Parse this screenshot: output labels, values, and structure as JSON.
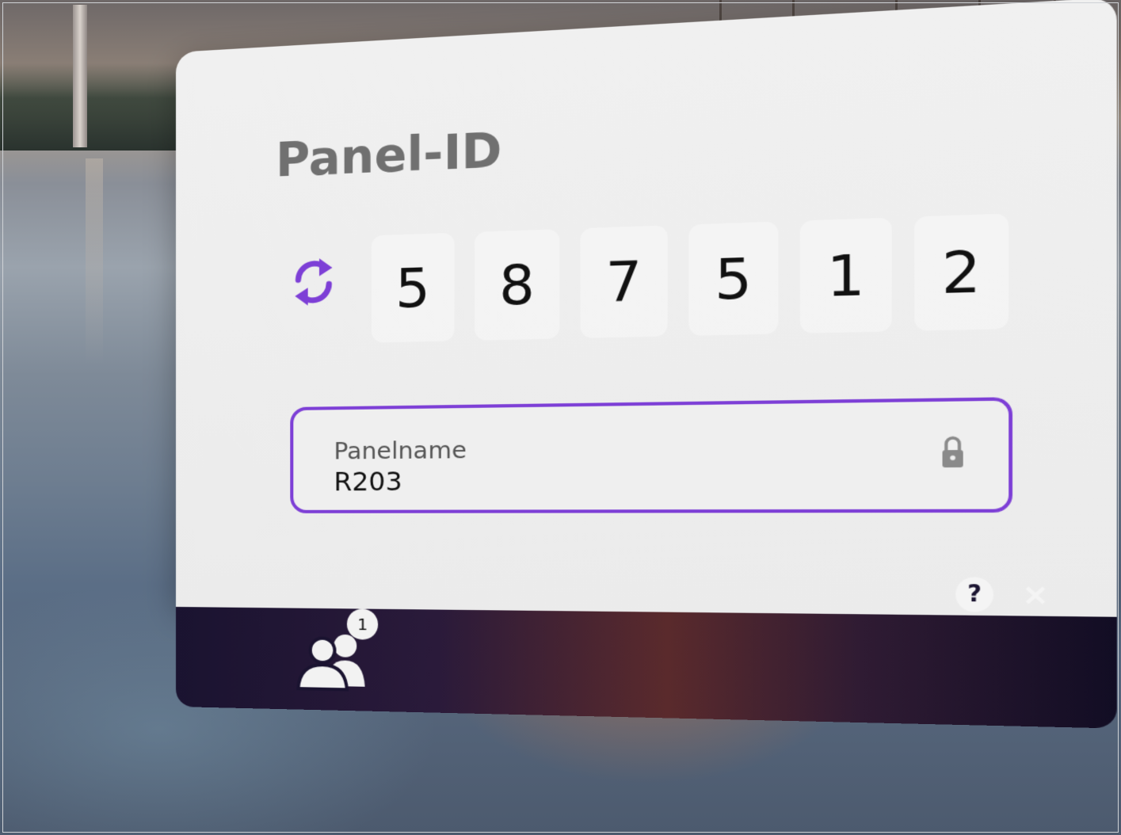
{
  "dialog": {
    "title": "Panel-ID",
    "refresh_icon": "refresh-icon",
    "panel_id_digits": [
      "5",
      "8",
      "7",
      "5",
      "1",
      "2"
    ],
    "panelname_field": {
      "label": "Panelname",
      "value": "R203",
      "lock_icon": "lock-icon"
    }
  },
  "footer": {
    "users_icon": "users-icon",
    "users_badge_count": "1",
    "help_label": "?",
    "close_label": "×"
  },
  "colors": {
    "accent": "#7d3fd6",
    "footer_bg": "#1a1330",
    "card_bg": "#f0f0f0",
    "title_text": "#707070"
  }
}
